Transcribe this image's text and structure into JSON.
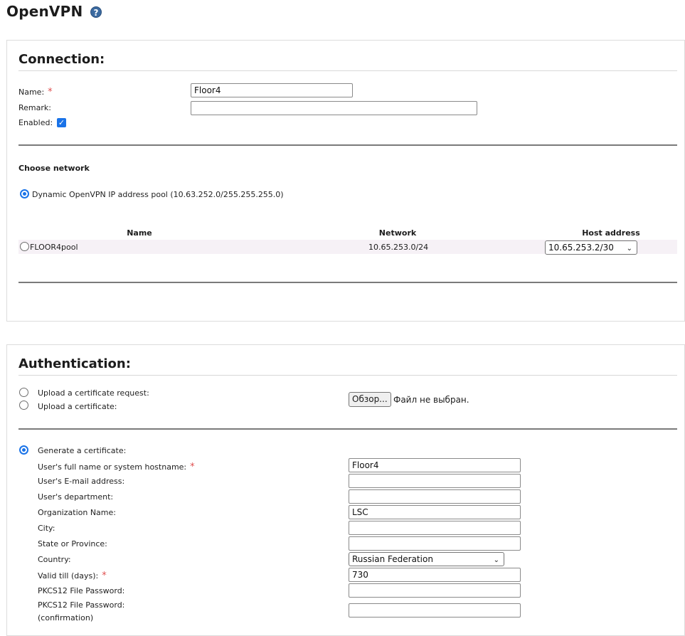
{
  "page": {
    "title": "OpenVPN",
    "help_glyph": "?"
  },
  "connection": {
    "title": "Connection:",
    "name_label": "Name:",
    "name_value": "Floor4",
    "remark_label": "Remark:",
    "remark_value": "",
    "enabled_label": "Enabled:",
    "enabled": true,
    "choose_network_title": "Choose network",
    "dynamic_pool_label": "Dynamic OpenVPN IP address pool (10.63.252.0/255.255.255.0)",
    "dynamic_pool_selected": true,
    "table": {
      "columns": [
        "Name",
        "Network",
        "Host address"
      ],
      "rows": [
        {
          "name": "FLOOR4pool",
          "network": "10.65.253.0/24",
          "host_address": "10.65.253.2/30",
          "selected": false
        }
      ]
    }
  },
  "authentication": {
    "title": "Authentication:",
    "upload_request_label": "Upload a certificate request:",
    "upload_cert_label": "Upload a certificate:",
    "browse_button": "Обзор...",
    "no_file_text": "Файл не выбран.",
    "generate_label": "Generate a certificate:",
    "generate_selected": true,
    "fields": {
      "full_name_label": "User's full name or system hostname:",
      "full_name_value": "Floor4",
      "email_label": "User's E-mail address:",
      "email_value": "",
      "department_label": "User's department:",
      "department_value": "",
      "org_label": "Organization Name:",
      "org_value": "LSC",
      "city_label": "City:",
      "city_value": "",
      "state_label": "State or Province:",
      "state_value": "",
      "country_label": "Country:",
      "country_value": "Russian Federation",
      "valid_label": "Valid till (days):",
      "valid_value": "730",
      "pkcs_label": "PKCS12 File Password:",
      "pkcs_value": "",
      "pkcs_confirm_label_1": "PKCS12 File Password:",
      "pkcs_confirm_label_2": "(confirmation)",
      "pkcs_confirm_value": ""
    },
    "required_mark": "*"
  },
  "colors": {
    "accent": "#1a73e8",
    "required": "#e05050",
    "row_highlight": "#f6f1f6"
  },
  "icons": {
    "help": "help-circle-icon",
    "select": "chevron-down-icon"
  }
}
